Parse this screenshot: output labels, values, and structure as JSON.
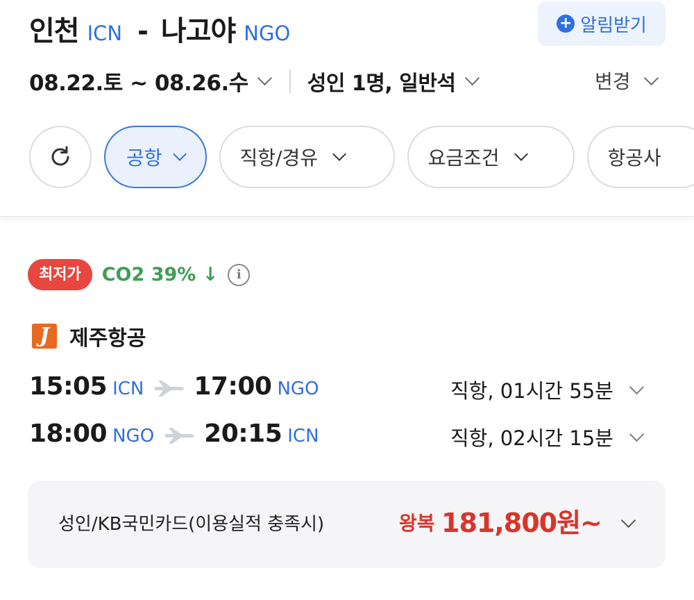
{
  "header": {
    "origin_city": "인천",
    "origin_code": "ICN",
    "separator": "-",
    "dest_city": "나고야",
    "dest_code": "NGO",
    "alarm_label": "알림받기",
    "dates": "08.22.토 ~ 08.26.수",
    "passengers": "성인 1명, 일반석",
    "change_label": "변경"
  },
  "filters": [
    {
      "label": "공항",
      "active": true
    },
    {
      "label": "직항/경유",
      "active": false
    },
    {
      "label": "요금조건",
      "active": false
    },
    {
      "label": "항공사",
      "active": false
    }
  ],
  "result": {
    "badge": "최저가",
    "co2": "CO2 39% ↓",
    "airline": "제주항공",
    "legs": [
      {
        "dep_time": "15:05",
        "dep_code": "ICN",
        "arr_time": "17:00",
        "arr_code": "NGO",
        "info": "직항, 01시간 55분"
      },
      {
        "dep_time": "18:00",
        "dep_code": "NGO",
        "arr_time": "20:15",
        "arr_code": "ICN",
        "info": "직항, 02시간 15분"
      }
    ],
    "fare_desc": "성인/KB국민카드(이용실적 충족시)",
    "fare_type": "왕복",
    "fare_price": "181,800원~"
  },
  "colors": {
    "accent": "#2f6fde",
    "low_badge": "#e8473f",
    "co2_green": "#3f9d56",
    "price_red": "#d8352a",
    "airline_orange": "#e8691f"
  },
  "icons": [
    "add-circle-icon",
    "chevron-down-icon",
    "refresh-icon",
    "info-icon",
    "airplane-icon",
    "jejuair-logo-icon"
  ]
}
